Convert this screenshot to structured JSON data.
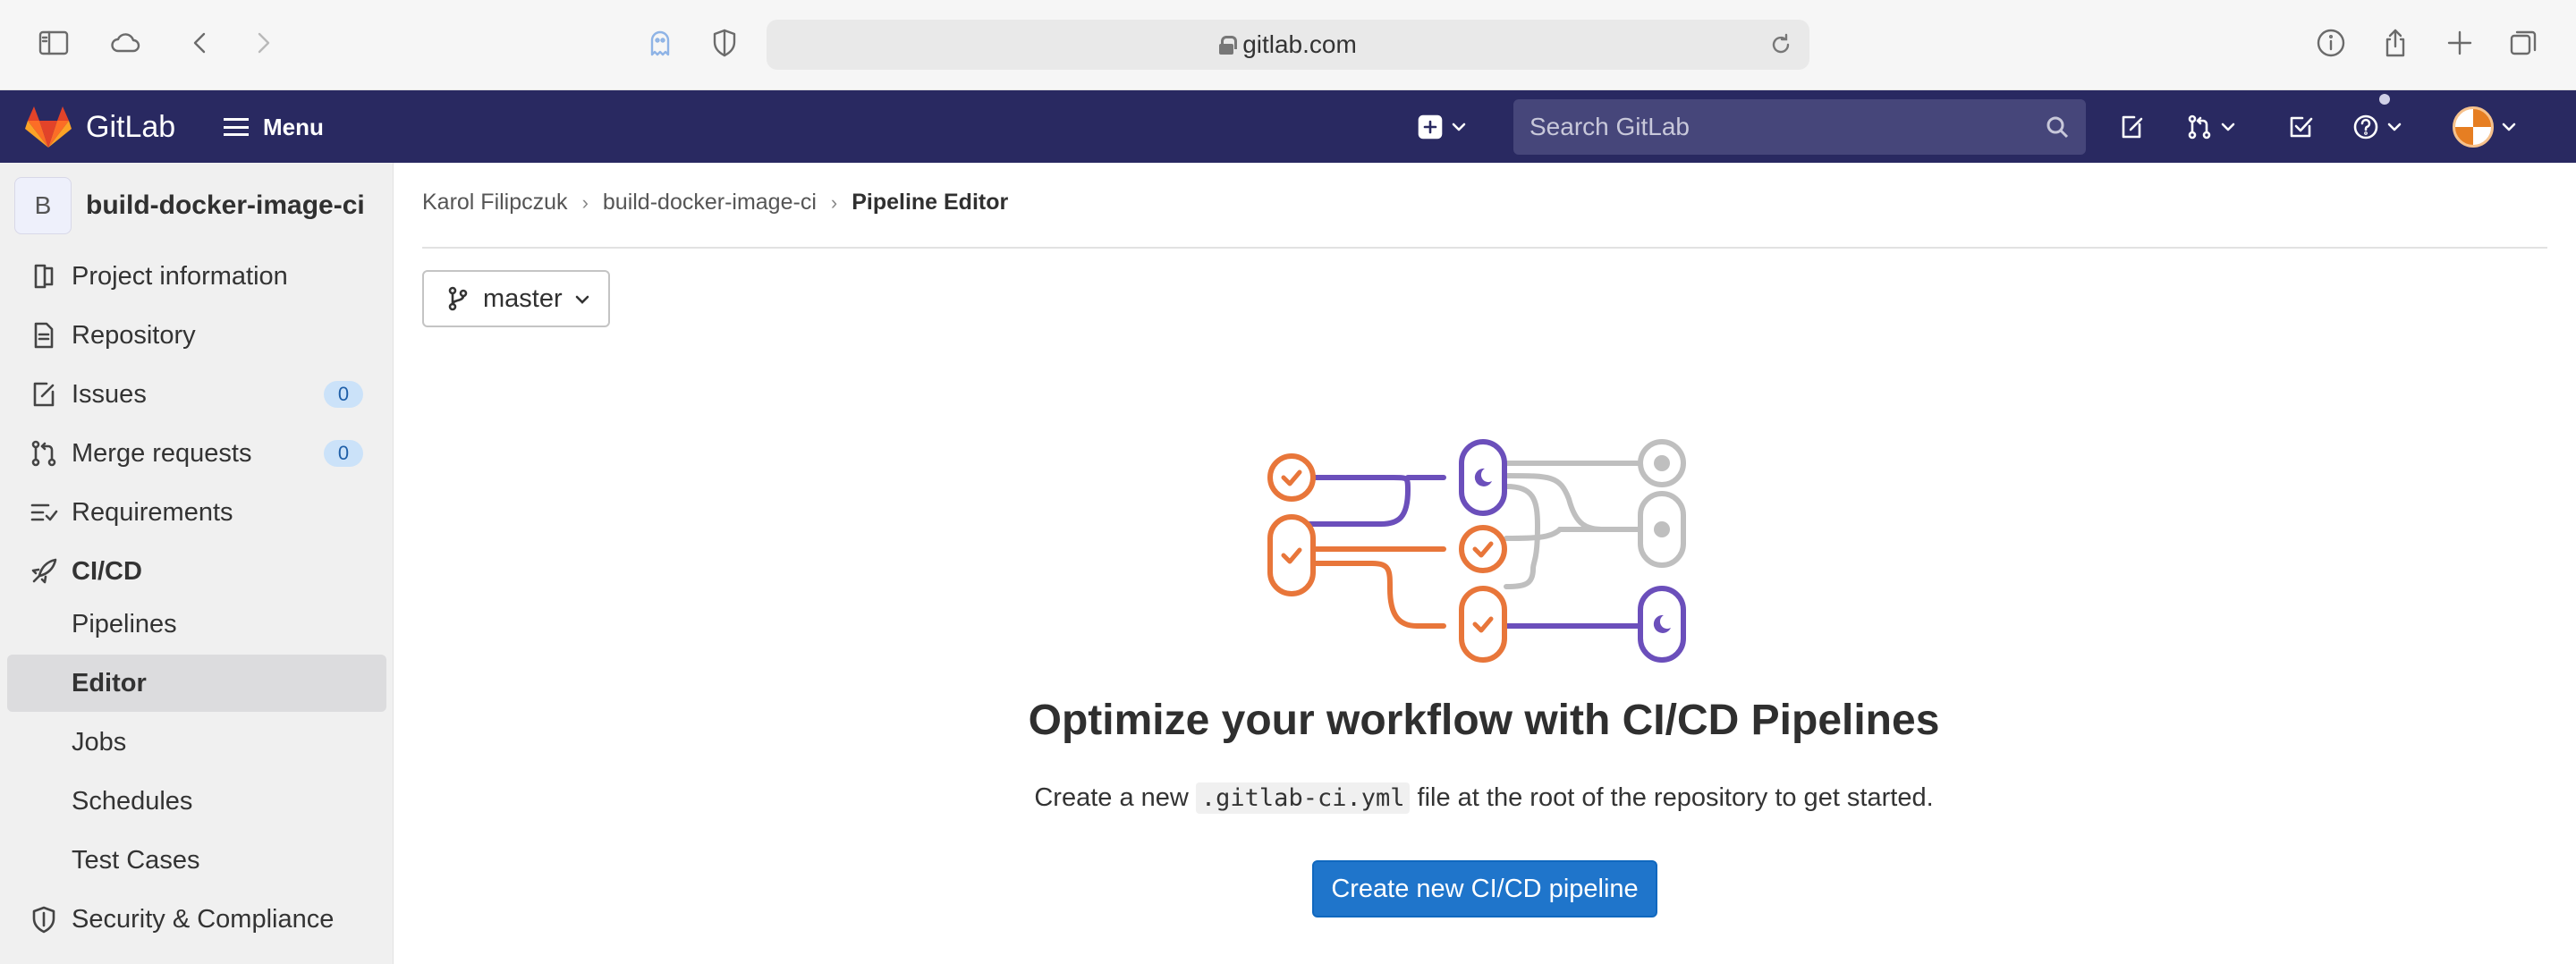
{
  "browser": {
    "url": "gitlab.com",
    "icons": [
      "sidebar-icon",
      "cloud-icon",
      "back-icon",
      "forward-icon",
      "ghost-icon",
      "shield-icon",
      "reload-icon",
      "info-icon",
      "share-icon",
      "new-tab-icon",
      "tabs-icon"
    ]
  },
  "topnav": {
    "brand": "GitLab",
    "menu_label": "Menu",
    "search_placeholder": "Search GitLab",
    "colors": {
      "background": "#292961",
      "search_bg": "#46467a"
    },
    "icons": [
      "plus-square-icon",
      "search-icon",
      "issues-icon",
      "merge-request-icon",
      "todo-icon",
      "help-icon",
      "user-avatar"
    ]
  },
  "sidebar": {
    "project_initial": "B",
    "project_name": "build-docker-image-ci",
    "items": [
      {
        "label": "Project information",
        "icon": "project-icon"
      },
      {
        "label": "Repository",
        "icon": "doc-icon"
      },
      {
        "label": "Issues",
        "icon": "issues-icon",
        "count": "0"
      },
      {
        "label": "Merge requests",
        "icon": "merge-request-icon",
        "count": "0"
      },
      {
        "label": "Requirements",
        "icon": "requirements-icon"
      },
      {
        "label": "CI/CD",
        "icon": "rocket-icon"
      }
    ],
    "cicd_subitems": [
      "Pipelines",
      "Editor",
      "Jobs",
      "Schedules",
      "Test Cases"
    ],
    "security": {
      "label": "Security & Compliance",
      "icon": "shield-icon"
    }
  },
  "breadcrumb": {
    "items": [
      "Karol Filipczuk",
      "build-docker-image-ci"
    ],
    "current": "Pipeline Editor"
  },
  "branch_selector": {
    "value": "master"
  },
  "empty_state": {
    "title": "Optimize your workflow with CI/CD Pipelines",
    "desc_before": "Create a new",
    "desc_code": ".gitlab-ci.yml",
    "desc_after": "file at the root of the repository to get started.",
    "button": "Create new CI/CD pipeline",
    "colors": {
      "orange": "#e8763a",
      "purple": "#6b4fbb",
      "gray": "#bfbfbf",
      "button": "#1f75cb"
    }
  }
}
